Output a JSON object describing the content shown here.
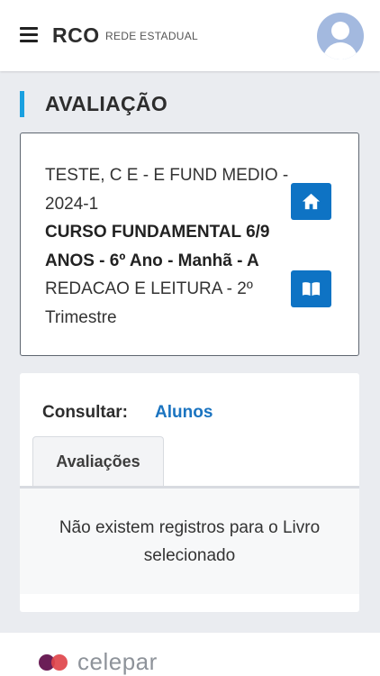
{
  "header": {
    "brand": "RCO",
    "brand_sub": "REDE ESTADUAL"
  },
  "page": {
    "title": "AVALIAÇÃO"
  },
  "class_card": {
    "line1": "TESTE, C E - E FUND MEDIO - 2024-1",
    "line2": "CURSO FUNDAMENTAL 6/9 ANOS - 6º Ano - Manhã - A",
    "line3": "REDACAO E LEITURA - 2º Trimestre",
    "home_icon": "home-icon",
    "book_icon": "book-icon"
  },
  "consult": {
    "label": "Consultar:",
    "link": "Alunos"
  },
  "tabs": [
    {
      "label": "Avaliações",
      "active": true
    }
  ],
  "empty_message": "Não existem registros para o Livro selecionado",
  "footer": {
    "logo_text": "celepar"
  },
  "colors": {
    "accent": "#1aa0e0",
    "button": "#0e73c4",
    "link": "#1b74c0",
    "logo_purple": "#6b1f57",
    "logo_red": "#e0454b"
  }
}
